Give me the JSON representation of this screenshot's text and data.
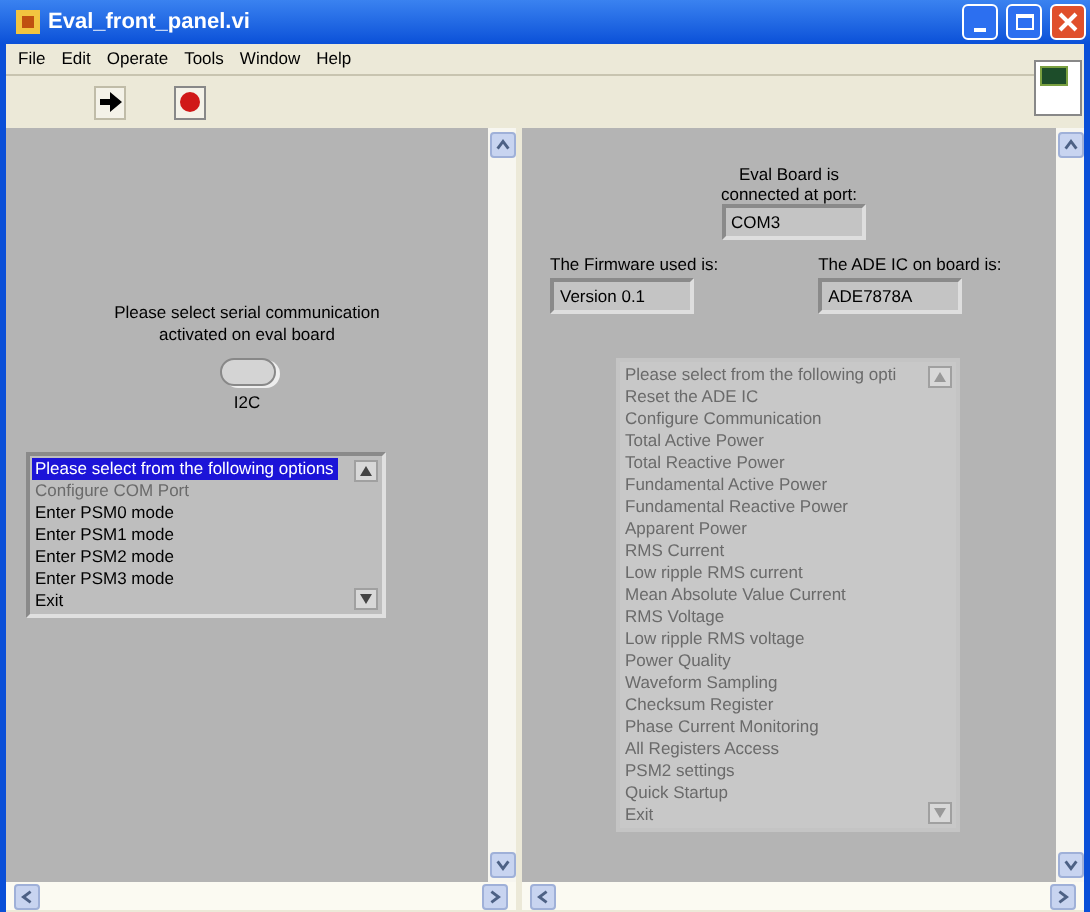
{
  "window": {
    "title": "Eval_front_panel.vi"
  },
  "menu": [
    "File",
    "Edit",
    "Operate",
    "Tools",
    "Window",
    "Help"
  ],
  "left_panel": {
    "prompt": "Please select serial communication activated on eval board",
    "switch": {
      "on": false
    },
    "switch_label": "I2C",
    "listbox": {
      "disabled": false,
      "items": [
        {
          "label": "Please select from the following options",
          "selected": true,
          "disabled": false
        },
        {
          "label": "Configure COM Port",
          "selected": false,
          "disabled": true
        },
        {
          "label": "Enter PSM0 mode",
          "selected": false,
          "disabled": false
        },
        {
          "label": "Enter PSM1 mode",
          "selected": false,
          "disabled": false
        },
        {
          "label": "Enter PSM2 mode",
          "selected": false,
          "disabled": false
        },
        {
          "label": "Enter PSM3 mode",
          "selected": false,
          "disabled": false
        },
        {
          "label": "Exit",
          "selected": false,
          "disabled": false
        }
      ]
    }
  },
  "right_panel": {
    "port_label": "Eval Board is connected at port:",
    "port_value": "COM3",
    "firmware_label": "The Firmware used is:",
    "firmware_value": "Version 0.1",
    "ic_label": "The ADE IC on board is:",
    "ic_value": "ADE7878A",
    "listbox": {
      "disabled": true,
      "items": [
        {
          "label": "Please select from the following opti",
          "selected": false
        },
        {
          "label": "Reset the ADE IC",
          "selected": false
        },
        {
          "label": "Configure Communication",
          "selected": false
        },
        {
          "label": "Total Active Power",
          "selected": false
        },
        {
          "label": "Total Reactive Power",
          "selected": false
        },
        {
          "label": "Fundamental Active Power",
          "selected": false
        },
        {
          "label": "Fundamental Reactive Power",
          "selected": false
        },
        {
          "label": "Apparent Power",
          "selected": false
        },
        {
          "label": "RMS Current",
          "selected": false
        },
        {
          "label": "Low ripple RMS current",
          "selected": false
        },
        {
          "label": "Mean Absolute Value Current",
          "selected": false
        },
        {
          "label": "RMS Voltage",
          "selected": false
        },
        {
          "label": "Low ripple RMS voltage",
          "selected": false
        },
        {
          "label": "Power Quality",
          "selected": false
        },
        {
          "label": "Waveform Sampling",
          "selected": false
        },
        {
          "label": "Checksum Register",
          "selected": false
        },
        {
          "label": "Phase Current Monitoring",
          "selected": false
        },
        {
          "label": "All Registers Access",
          "selected": false
        },
        {
          "label": "PSM2 settings",
          "selected": false
        },
        {
          "label": "Quick Startup",
          "selected": false
        },
        {
          "label": "Exit",
          "selected": false
        }
      ]
    }
  }
}
